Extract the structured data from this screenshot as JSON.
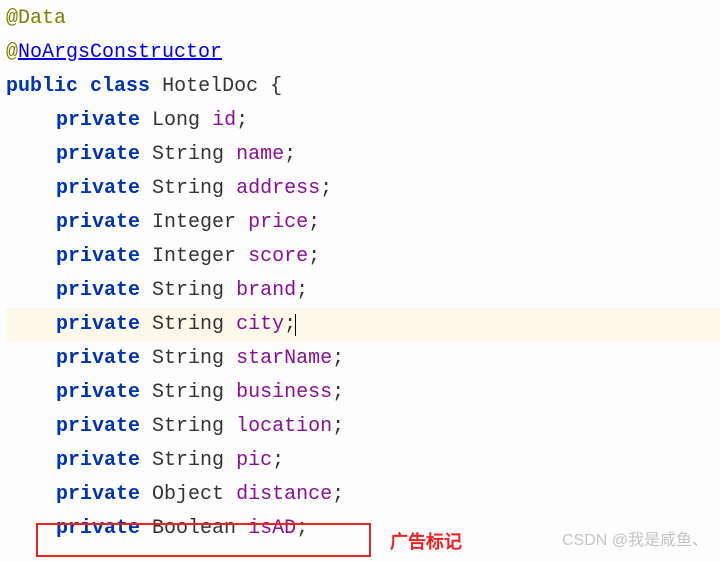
{
  "annotations": {
    "data_at": "@",
    "data_name": "Data",
    "noargs_at": "@",
    "noargs_name": "NoArgsConstructor"
  },
  "class_decl": {
    "kw_public": "public",
    "kw_class": "class",
    "name": "HotelDoc",
    "brace": "{"
  },
  "fields": [
    {
      "kw": "private",
      "type": "Long",
      "name": "id",
      "highlight": false
    },
    {
      "kw": "private",
      "type": "String",
      "name": "name",
      "highlight": false
    },
    {
      "kw": "private",
      "type": "String",
      "name": "address",
      "highlight": false
    },
    {
      "kw": "private",
      "type": "Integer",
      "name": "price",
      "highlight": false
    },
    {
      "kw": "private",
      "type": "Integer",
      "name": "score",
      "highlight": false
    },
    {
      "kw": "private",
      "type": "String",
      "name": "brand",
      "highlight": false
    },
    {
      "kw": "private",
      "type": "String",
      "name": "city",
      "highlight": true
    },
    {
      "kw": "private",
      "type": "String",
      "name": "starName",
      "highlight": false
    },
    {
      "kw": "private",
      "type": "String",
      "name": "business",
      "highlight": false
    },
    {
      "kw": "private",
      "type": "String",
      "name": "location",
      "highlight": false
    },
    {
      "kw": "private",
      "type": "String",
      "name": "pic",
      "highlight": false
    },
    {
      "kw": "private",
      "type": "Object",
      "name": "distance",
      "highlight": false
    },
    {
      "kw": "private",
      "type": "Boolean",
      "name": "isAD",
      "highlight": false
    }
  ],
  "semi": ";",
  "red_label": "广告标记",
  "watermark": "CSDN @我是咸鱼、"
}
